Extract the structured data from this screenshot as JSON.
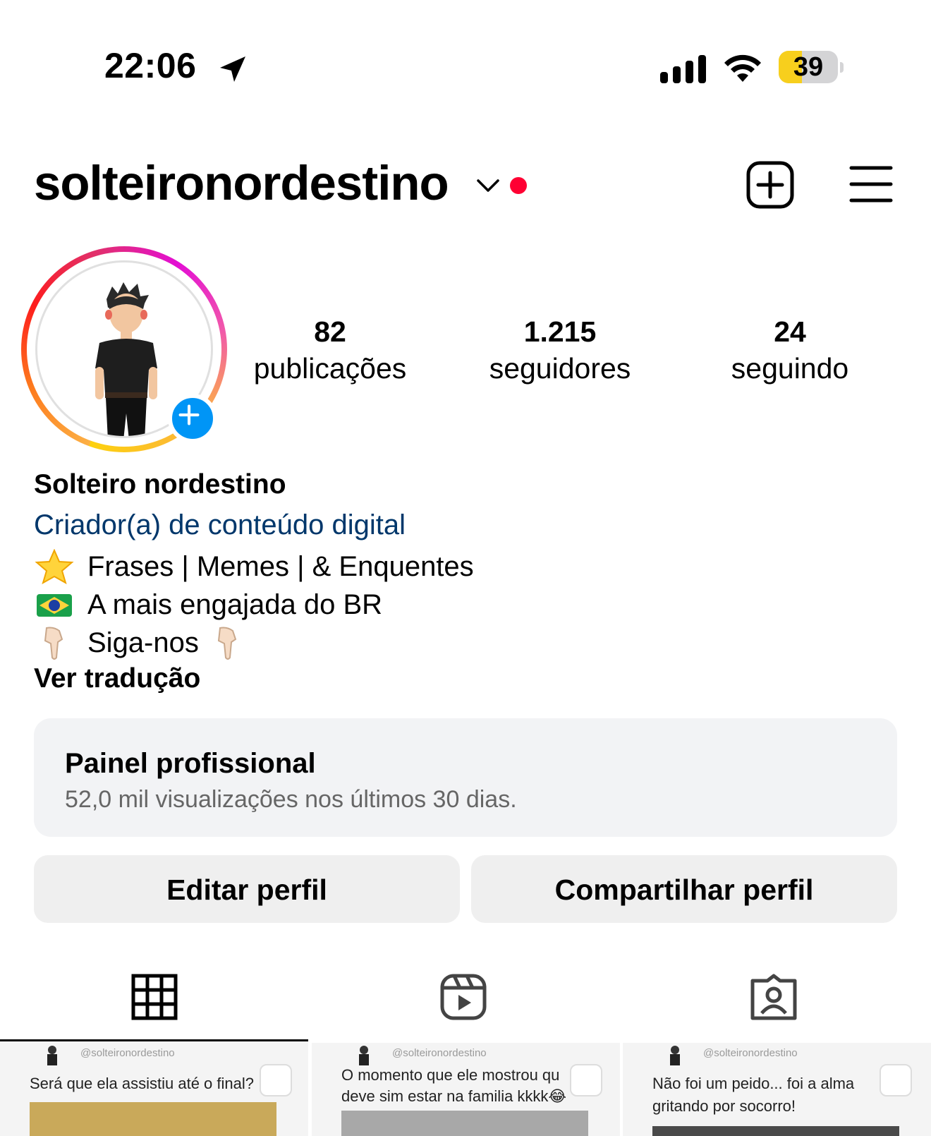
{
  "status_bar": {
    "time": "22:06",
    "battery": "39",
    "battery_level": 0.39,
    "icons": [
      "location-arrow-icon",
      "signal-icon",
      "wifi-icon",
      "battery-icon"
    ]
  },
  "header": {
    "username": "solteironordestino",
    "icons": [
      "chevron-down-icon",
      "notification-dot",
      "new-post-icon",
      "menu-icon"
    ]
  },
  "profile": {
    "stats": [
      {
        "value": "82",
        "label": "publicações"
      },
      {
        "value": "1.215",
        "label": "seguidores"
      },
      {
        "value": "24",
        "label": "seguindo"
      }
    ],
    "display_name": "Solteiro nordestino",
    "category": "Criador(a) de conteúdo digital",
    "bio": [
      {
        "icon": "star-emoji",
        "text": "Frases | Memes | & Enquentes"
      },
      {
        "icon": "brazil-flag-emoji",
        "text": "A mais engajada do BR"
      },
      {
        "icon": "pointing-down-emoji",
        "text": "Siga-nos",
        "trailing_icon": "pointing-down-emoji"
      }
    ],
    "translate_link": "Ver tradução"
  },
  "dashboard": {
    "title": "Painel profissional",
    "subtitle": "52,0 mil visualizações nos últimos 30 dias."
  },
  "buttons": {
    "edit": "Editar perfil",
    "share": "Compartilhar perfil"
  },
  "tabs": [
    "grid-icon",
    "reels-icon",
    "tagged-icon"
  ],
  "posts": [
    {
      "handle": "@solteironordestino",
      "caption": [
        "Será que ela assistiu até o final?"
      ]
    },
    {
      "handle": "@solteironordestino",
      "caption": [
        "O momento que ele mostrou qu",
        "deve sim estar na familia kkkk😂"
      ]
    },
    {
      "handle": "@solteironordestino",
      "caption": [
        "Não foi um peido... foi a alma",
        "gritando por socorro!"
      ]
    }
  ],
  "colors": {
    "accent_blue": "#0095f6",
    "category_link": "#00376b",
    "notification_red": "#ff0033",
    "battery_yellow": "#f7cf1d"
  }
}
